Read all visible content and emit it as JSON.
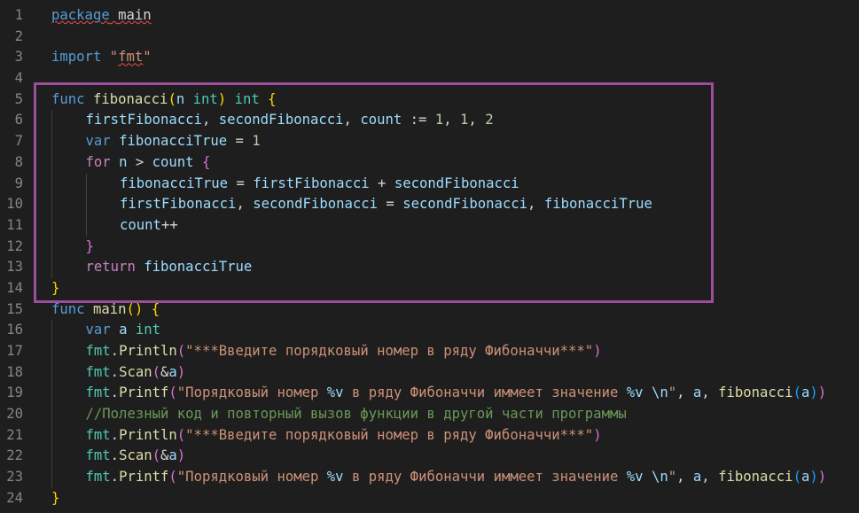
{
  "editor": {
    "language": "go",
    "colors": {
      "background": "#1e1e1e",
      "highlight_box": "#9b4f9b",
      "line_number": "#858585",
      "keyword": "#569cd6",
      "function": "#dcdcaa",
      "type": "#4ec9b0",
      "string": "#ce9178",
      "comment": "#6a9955"
    },
    "highlighted_lines": [
      5,
      14
    ],
    "lines": [
      {
        "n": "1",
        "indent": 0,
        "tokens": [
          [
            "kw squig",
            "package"
          ],
          [
            "op squig",
            " "
          ],
          [
            "op squig",
            "main"
          ]
        ]
      },
      {
        "n": "2",
        "indent": 0,
        "tokens": []
      },
      {
        "n": "3",
        "indent": 0,
        "tokens": [
          [
            "kw",
            "import"
          ],
          [
            "op",
            " "
          ],
          [
            "str",
            "\""
          ],
          [
            "str squig",
            "fmt"
          ],
          [
            "str",
            "\""
          ]
        ]
      },
      {
        "n": "4",
        "indent": 0,
        "tokens": []
      },
      {
        "n": "5",
        "indent": 0,
        "tokens": [
          [
            "kw",
            "func"
          ],
          [
            "op",
            " "
          ],
          [
            "fn",
            "fibonacci"
          ],
          [
            "b1",
            "("
          ],
          [
            "id",
            "n"
          ],
          [
            "op",
            " "
          ],
          [
            "ty",
            "int"
          ],
          [
            "b1",
            ")"
          ],
          [
            "op",
            " "
          ],
          [
            "ty",
            "int"
          ],
          [
            "op",
            " "
          ],
          [
            "b1",
            "{"
          ]
        ]
      },
      {
        "n": "6",
        "indent": 1,
        "tokens": [
          [
            "id",
            "firstFibonacci"
          ],
          [
            "op",
            ", "
          ],
          [
            "id",
            "secondFibonacci"
          ],
          [
            "op",
            ", "
          ],
          [
            "id",
            "count"
          ],
          [
            "op",
            " := "
          ],
          [
            "num",
            "1"
          ],
          [
            "op",
            ", "
          ],
          [
            "num",
            "1"
          ],
          [
            "op",
            ", "
          ],
          [
            "num",
            "2"
          ]
        ]
      },
      {
        "n": "7",
        "indent": 1,
        "tokens": [
          [
            "kw",
            "var"
          ],
          [
            "op",
            " "
          ],
          [
            "id",
            "fibonacciTrue"
          ],
          [
            "op",
            " = "
          ],
          [
            "num",
            "1"
          ]
        ]
      },
      {
        "n": "8",
        "indent": 1,
        "tokens": [
          [
            "ctl",
            "for"
          ],
          [
            "op",
            " "
          ],
          [
            "id",
            "n"
          ],
          [
            "op",
            " > "
          ],
          [
            "id",
            "count"
          ],
          [
            "op",
            " "
          ],
          [
            "b2",
            "{"
          ]
        ]
      },
      {
        "n": "9",
        "indent": 2,
        "tokens": [
          [
            "id",
            "fibonacciTrue"
          ],
          [
            "op",
            " = "
          ],
          [
            "id",
            "firstFibonacci"
          ],
          [
            "op",
            " + "
          ],
          [
            "id",
            "secondFibonacci"
          ]
        ]
      },
      {
        "n": "10",
        "indent": 2,
        "tokens": [
          [
            "id",
            "firstFibonacci"
          ],
          [
            "op",
            ", "
          ],
          [
            "id",
            "secondFibonacci"
          ],
          [
            "op",
            " = "
          ],
          [
            "id",
            "secondFibonacci"
          ],
          [
            "op",
            ", "
          ],
          [
            "id",
            "fibonacciTrue"
          ]
        ]
      },
      {
        "n": "11",
        "indent": 2,
        "tokens": [
          [
            "id",
            "count"
          ],
          [
            "op",
            "++"
          ]
        ]
      },
      {
        "n": "12",
        "indent": 1,
        "tokens": [
          [
            "b2",
            "}"
          ]
        ]
      },
      {
        "n": "13",
        "indent": 1,
        "tokens": [
          [
            "ctl",
            "return"
          ],
          [
            "op",
            " "
          ],
          [
            "id",
            "fibonacciTrue"
          ]
        ]
      },
      {
        "n": "14",
        "indent": 0,
        "tokens": [
          [
            "b1",
            "}"
          ]
        ]
      },
      {
        "n": "15",
        "indent": 0,
        "tokens": [
          [
            "kw",
            "func"
          ],
          [
            "op",
            " "
          ],
          [
            "fn",
            "main"
          ],
          [
            "b1",
            "("
          ],
          [
            "b1",
            ")"
          ],
          [
            "op",
            " "
          ],
          [
            "b1",
            "{"
          ]
        ]
      },
      {
        "n": "16",
        "indent": 1,
        "tokens": [
          [
            "kw",
            "var"
          ],
          [
            "op",
            " "
          ],
          [
            "id",
            "a"
          ],
          [
            "op",
            " "
          ],
          [
            "ty",
            "int"
          ]
        ]
      },
      {
        "n": "17",
        "indent": 1,
        "tokens": [
          [
            "ty",
            "fmt"
          ],
          [
            "op",
            "."
          ],
          [
            "fn",
            "Println"
          ],
          [
            "b2",
            "("
          ],
          [
            "str",
            "\"***Введите порядковый номер в ряду Фибоначчи***\""
          ],
          [
            "b2",
            ")"
          ]
        ]
      },
      {
        "n": "18",
        "indent": 1,
        "tokens": [
          [
            "ty",
            "fmt"
          ],
          [
            "op",
            "."
          ],
          [
            "fn",
            "Scan"
          ],
          [
            "b2",
            "("
          ],
          [
            "op",
            "&"
          ],
          [
            "id",
            "a"
          ],
          [
            "b2",
            ")"
          ]
        ]
      },
      {
        "n": "19",
        "indent": 1,
        "tokens": [
          [
            "ty",
            "fmt"
          ],
          [
            "op",
            "."
          ],
          [
            "fn",
            "Printf"
          ],
          [
            "b2",
            "("
          ],
          [
            "str",
            "\"Порядковый номер "
          ],
          [
            "id",
            "%v"
          ],
          [
            "str",
            " в ряду Фибоначчи иммеет значение "
          ],
          [
            "id",
            "%v"
          ],
          [
            "str",
            " "
          ],
          [
            "id",
            "\\n"
          ],
          [
            "str",
            "\""
          ],
          [
            "op",
            ", "
          ],
          [
            "id",
            "a"
          ],
          [
            "op",
            ", "
          ],
          [
            "fn",
            "fibonacci"
          ],
          [
            "b3",
            "("
          ],
          [
            "id",
            "a"
          ],
          [
            "b3",
            ")"
          ],
          [
            "b2",
            ")"
          ]
        ]
      },
      {
        "n": "20",
        "indent": 1,
        "tokens": [
          [
            "cm",
            "//Полезный код и повторный вызов функции в другой части программы"
          ]
        ]
      },
      {
        "n": "21",
        "indent": 1,
        "tokens": [
          [
            "ty",
            "fmt"
          ],
          [
            "op",
            "."
          ],
          [
            "fn",
            "Println"
          ],
          [
            "b2",
            "("
          ],
          [
            "str",
            "\"***Введите порядковый номер в ряду Фибоначчи***\""
          ],
          [
            "b2",
            ")"
          ]
        ]
      },
      {
        "n": "22",
        "indent": 1,
        "tokens": [
          [
            "ty",
            "fmt"
          ],
          [
            "op",
            "."
          ],
          [
            "fn",
            "Scan"
          ],
          [
            "b2",
            "("
          ],
          [
            "op",
            "&"
          ],
          [
            "id",
            "a"
          ],
          [
            "b2",
            ")"
          ]
        ]
      },
      {
        "n": "23",
        "indent": 1,
        "tokens": [
          [
            "ty",
            "fmt"
          ],
          [
            "op",
            "."
          ],
          [
            "fn",
            "Printf"
          ],
          [
            "b2",
            "("
          ],
          [
            "str",
            "\"Порядковый номер "
          ],
          [
            "id",
            "%v"
          ],
          [
            "str",
            " в ряду Фибоначчи иммеет значение "
          ],
          [
            "id",
            "%v"
          ],
          [
            "str",
            " "
          ],
          [
            "id",
            "\\n"
          ],
          [
            "str",
            "\""
          ],
          [
            "op",
            ", "
          ],
          [
            "id",
            "a"
          ],
          [
            "op",
            ", "
          ],
          [
            "fn",
            "fibonacci"
          ],
          [
            "b3",
            "("
          ],
          [
            "id",
            "a"
          ],
          [
            "b3",
            ")"
          ],
          [
            "b2",
            ")"
          ]
        ]
      },
      {
        "n": "24",
        "indent": 0,
        "tokens": [
          [
            "b1",
            "}"
          ]
        ]
      }
    ]
  }
}
